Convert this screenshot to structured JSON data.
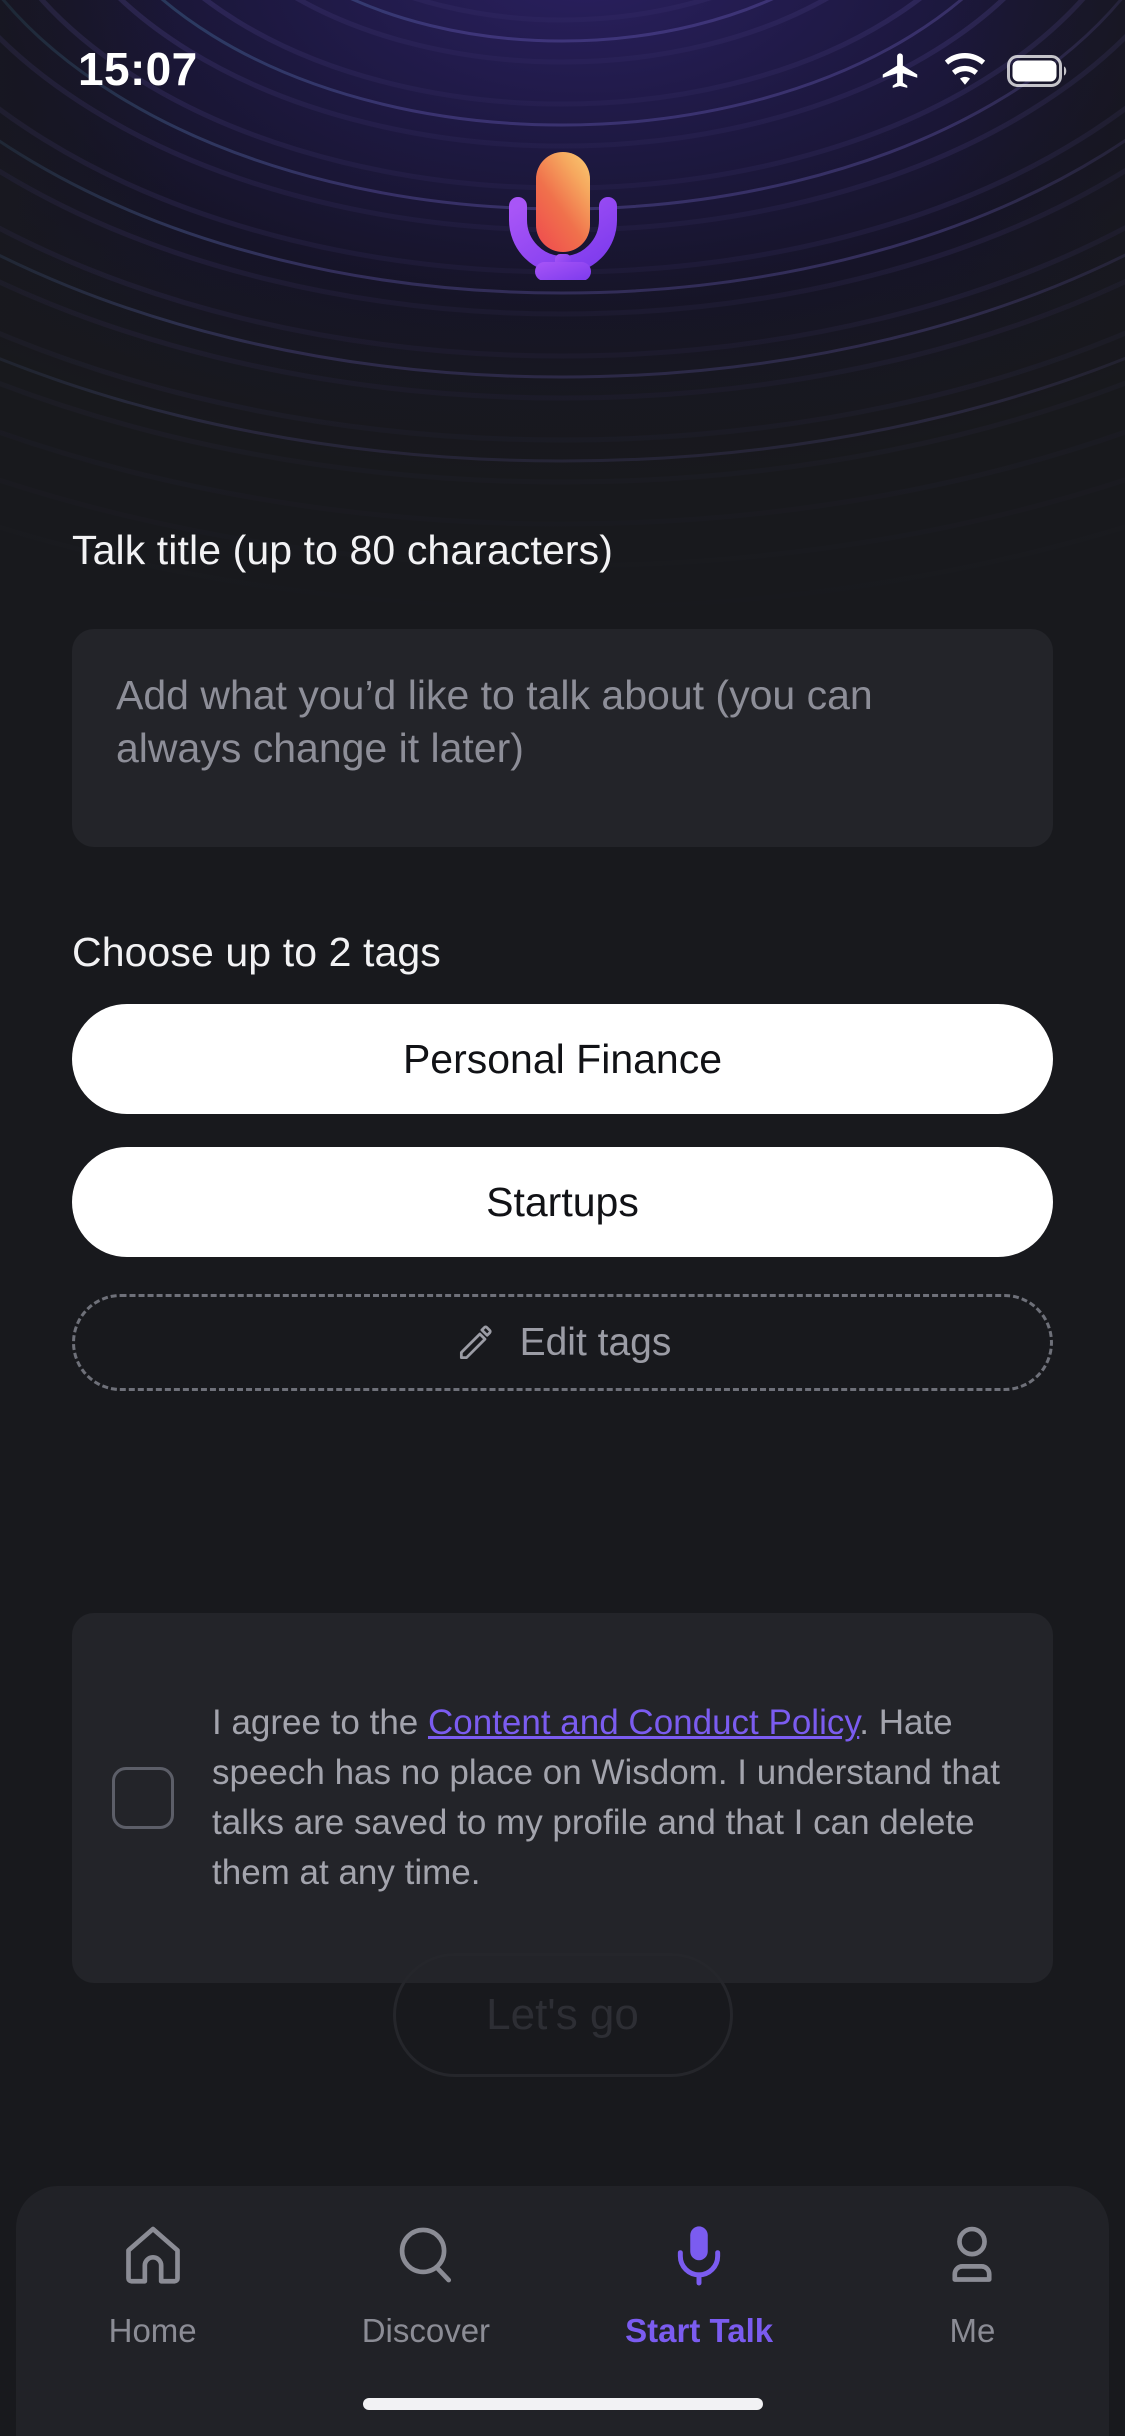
{
  "status_bar": {
    "time": "15:07",
    "icons": [
      "airplane-mode-icon",
      "wifi-icon",
      "battery-icon"
    ]
  },
  "brand": {
    "logo": "microphone-logo",
    "accent_purple": "#7B5CF0",
    "mic_orange_top": "#F7B267",
    "mic_orange_bottom": "#EF5E4E"
  },
  "form": {
    "title_label": "Talk title (up to 80 characters)",
    "title_value": "",
    "title_placeholder": "Add what you’d like to talk about (you can always change it later)",
    "tags_label": "Choose up to 2 tags",
    "tags": [
      {
        "label": "Personal Finance",
        "selected": true
      },
      {
        "label": "Startups",
        "selected": true
      }
    ],
    "edit_tags_label": "Edit tags",
    "edit_tags_icon": "pencil-icon"
  },
  "policy": {
    "checked": false,
    "text_before_link": "I agree to the ",
    "link_text": "Content and Conduct Policy",
    "text_after_link": ". Hate speech has no place on Wisdom. I understand that talks are saved to my profile and that I can delete them at any time.",
    "link_color": "#7B5CF0"
  },
  "submit": {
    "label": "Let's go",
    "enabled": false
  },
  "tabbar": {
    "items": [
      {
        "label": "Home",
        "icon": "home-icon",
        "active": false
      },
      {
        "label": "Discover",
        "icon": "search-icon",
        "active": false
      },
      {
        "label": "Start Talk",
        "icon": "microphone-icon",
        "active": true
      },
      {
        "label": "Me",
        "icon": "person-icon",
        "active": false
      }
    ]
  }
}
